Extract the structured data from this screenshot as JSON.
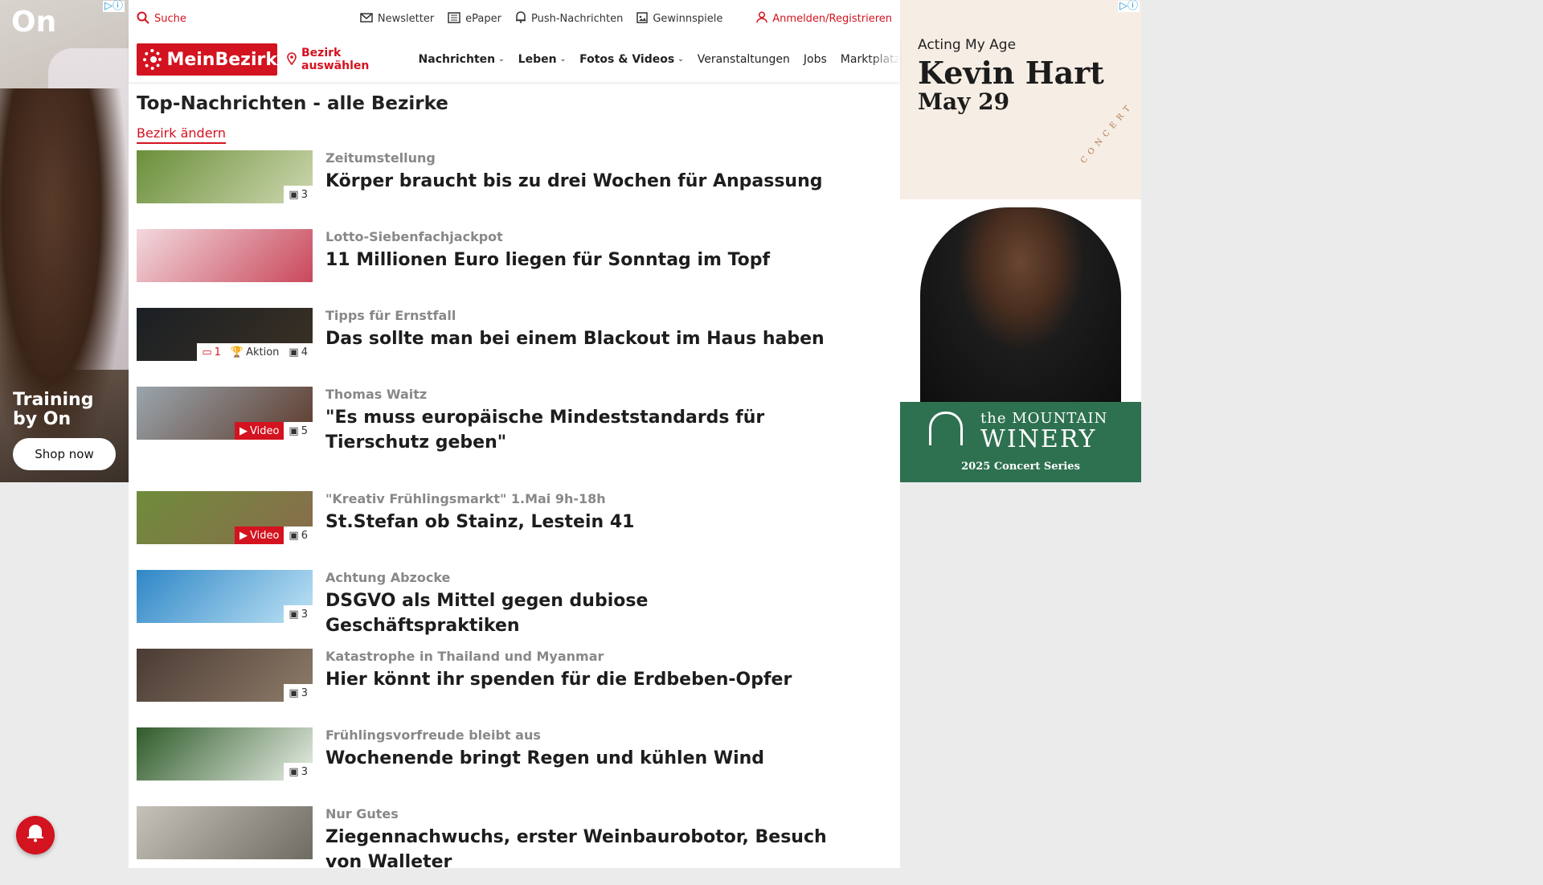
{
  "topbar": {
    "search_label": "Suche",
    "newsletter_label": "Newsletter",
    "epaper_label": "ePaper",
    "push_label": "Push-Nachrichten",
    "contests_label": "Gewinnspiele",
    "login_label": "Anmelden/Registrieren"
  },
  "nav": {
    "brand": "MeinBezirk",
    "district_label": "Bezirk auswählen",
    "items": [
      {
        "label": "Nachrichten",
        "dropdown": true
      },
      {
        "label": "Leben",
        "dropdown": true
      },
      {
        "label": "Fotos & Videos",
        "dropdown": true
      },
      {
        "label": "Veranstaltungen",
        "dropdown": false
      },
      {
        "label": "Jobs",
        "dropdown": false
      },
      {
        "label": "Marktplatz",
        "dropdown": false
      }
    ]
  },
  "main": {
    "section_title": "Top-Nachrichten - alle Bezirke",
    "change_district_label": "Bezirk ändern",
    "articles": [
      {
        "kicker": "Zeitumstellung",
        "headline": "Körper braucht bis zu drei Wochen für Anpassung",
        "images": "3",
        "thumb_color": [
          "#6a8f3a",
          "#cfd8b0"
        ]
      },
      {
        "kicker": "Lotto-Siebenfachjackpot",
        "headline": "11 Millionen Euro liegen für Sonntag im Topf",
        "images": "",
        "thumb_color": [
          "#f2d9de",
          "#c9485b"
        ]
      },
      {
        "kicker": "Tipps für Ernstfall",
        "headline": "Das sollte man bei einem Blackout im Haus haben",
        "images": "4",
        "comments": "1",
        "action": "Aktion",
        "thumb_color": [
          "#1b1f24",
          "#3a3124"
        ]
      },
      {
        "kicker": "Thomas Waitz",
        "headline": "\"Es muss europäische Mindeststandards für Tierschutz geben\"",
        "images": "5",
        "video": "Video",
        "thumb_color": [
          "#9aa6ad",
          "#5d3a2c"
        ]
      },
      {
        "kicker": "\"Kreativ Frühlingsmarkt\" 1.Mai 9h-18h",
        "headline": "St.Stefan ob Stainz, Lestein 41",
        "images": "6",
        "video": "Video",
        "thumb_color": [
          "#6f8c3b",
          "#8a6b4c"
        ]
      },
      {
        "kicker": "Achtung Abzocke",
        "headline": "DSGVO als Mittel gegen dubiose Geschäftspraktiken",
        "images": "3",
        "thumb_color": [
          "#2f87c7",
          "#bfe3f5"
        ]
      },
      {
        "kicker": "Katastrophe in Thailand und Myanmar",
        "headline": "Hier könnt ihr spenden für die Erdbeben-Opfer",
        "images": "3",
        "thumb_color": [
          "#4a3b33",
          "#8f7c6a"
        ]
      },
      {
        "kicker": "Frühlingsvorfreude bleibt aus",
        "headline": "Wochenende bringt Regen und kühlen Wind",
        "images": "3",
        "thumb_color": [
          "#2f5b2a",
          "#e9efe6"
        ]
      },
      {
        "kicker": "Nur Gutes",
        "headline": "Ziegennachwuchs, erster Weinbaurobotor, Besuch von Walleter",
        "images": "",
        "thumb_color": [
          "#c7c2b9",
          "#6e6b63"
        ]
      }
    ]
  },
  "ad_left": {
    "brand": "On",
    "tagline": "Training by On",
    "cta": "Shop now"
  },
  "ad_right": {
    "subtitle": "Acting My Age",
    "name": "Kevin Hart",
    "date": "May 29",
    "concert_word": "CONCERT",
    "venue_small": "the",
    "venue_line1": "MOUNTAIN",
    "venue_line2": "WINERY",
    "series": "2025 Concert Series"
  },
  "colors": {
    "brand_red": "#d3131f",
    "winery_green": "#2e7150"
  }
}
